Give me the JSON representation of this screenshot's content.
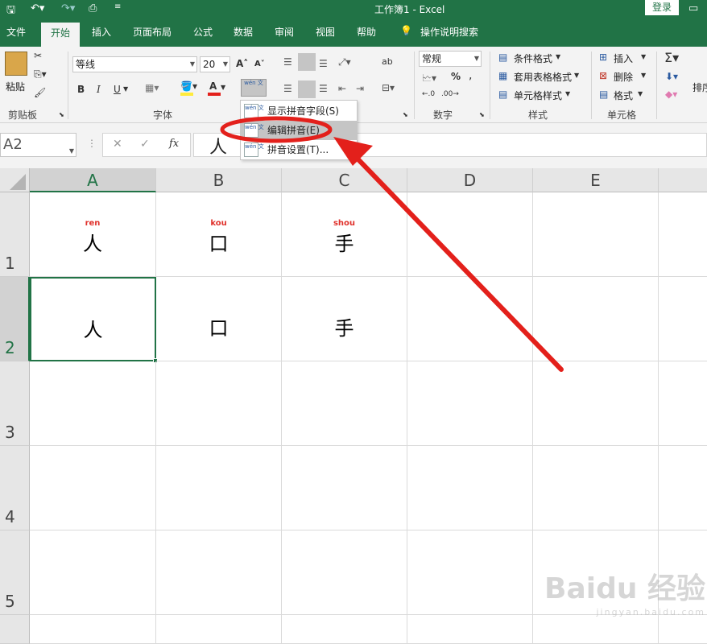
{
  "title_bar": {
    "title": "工作簿1 - Excel",
    "login": "登录"
  },
  "tabs": [
    "文件",
    "开始",
    "插入",
    "页面布局",
    "公式",
    "数据",
    "审阅",
    "视图",
    "帮助"
  ],
  "tell_me": "操作说明搜索",
  "ribbon": {
    "clipboard": {
      "paste": "粘贴",
      "group": "剪贴板"
    },
    "font": {
      "name": "等线",
      "size": "20",
      "bold": "B",
      "italic": "I",
      "underline": "U",
      "group": "字体",
      "font_color_letter": "A",
      "phonetic_icon": "wén 文"
    },
    "number": {
      "format": "常规",
      "percent": "%",
      "group": "数字"
    },
    "alignment": {
      "wrap": "ab"
    },
    "styles": {
      "conditional": "条件格式",
      "table": "套用表格格式",
      "cell": "单元格样式",
      "group": "样式"
    },
    "cells": {
      "insert": "插入",
      "delete": "删除",
      "format": "格式",
      "group": "单元格"
    },
    "editing": {
      "sort": "排序"
    }
  },
  "phonetic_menu": [
    {
      "label": "显示拼音字段(S)",
      "icon": "wén 文"
    },
    {
      "label": "编辑拼音(E)",
      "icon": "wén 文"
    },
    {
      "label": "拼音设置(T)...",
      "icon": "wén 文"
    }
  ],
  "formula_bar": {
    "name_box": "A2",
    "content": "人",
    "cancel": "✕",
    "enter": "✓",
    "fx": "fx"
  },
  "columns": [
    "A",
    "B",
    "C",
    "D",
    "E"
  ],
  "rows": [
    "1",
    "2",
    "3",
    "4",
    "5"
  ],
  "cells": {
    "r1": [
      {
        "char": "人",
        "pinyin": "ren"
      },
      {
        "char": "口",
        "pinyin": "kou"
      },
      {
        "char": "手",
        "pinyin": "shou"
      }
    ],
    "r2": [
      {
        "char": "人"
      },
      {
        "char": "口"
      },
      {
        "char": "手"
      }
    ]
  },
  "watermark": "Baidu 经验 jingyan.baidu.com",
  "colors": {
    "excel_green": "#217346",
    "annotation_red": "#e3201b",
    "pinyin_red": "#e0312b"
  }
}
